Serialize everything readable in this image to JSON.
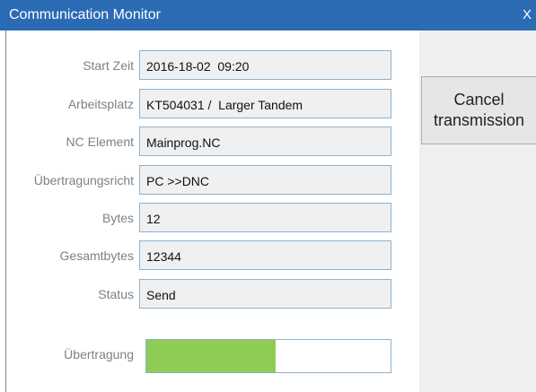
{
  "window": {
    "title": "Communication Monitor",
    "close_label": "X",
    "accent_color": "#2b6bb4"
  },
  "actions": {
    "cancel_label": "Cancel\ntransmission"
  },
  "fields": [
    {
      "label": "Start Zeit",
      "value": "2016-18-02  09:20"
    },
    {
      "label": "Arbeitsplatz",
      "value": "KT504031 /  Larger Tandem"
    },
    {
      "label": "NC Element",
      "value": "Mainprog.NC"
    },
    {
      "label": "Übertragungsricht",
      "value": "PC >>DNC"
    },
    {
      "label": "Bytes",
      "value": "12"
    },
    {
      "label": "Gesamtbytes",
      "value": "12344"
    },
    {
      "label": "Status",
      "value": "Send"
    }
  ],
  "progress": {
    "label": "Übertragung",
    "fraction": 0.53,
    "fill_color": "#8dcd55"
  }
}
